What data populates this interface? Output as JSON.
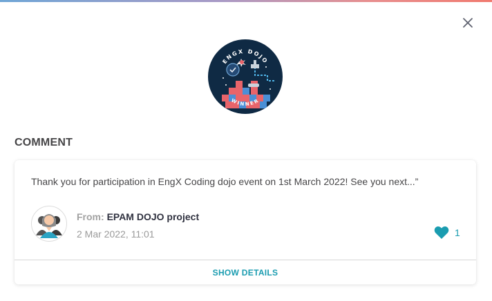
{
  "dialog": {
    "close_icon": "close-icon",
    "badge": {
      "top_text": "ENGX DOJO",
      "bottom_text": "WINNER",
      "background_color": "#0f2a44",
      "accent_color": "#e8646a"
    }
  },
  "section": {
    "title": "COMMENT"
  },
  "comment": {
    "text": "Thank you for participation in EngX Coding dojo event on 1st March 2022! See you next...”",
    "from_label": "From:",
    "from_name": "EPAM DOJO project",
    "date": "2 Mar 2022, 11:01",
    "like_count": "1",
    "like_icon": "heart-icon",
    "show_details_label": "SHOW DETAILS"
  },
  "colors": {
    "accent": "#1a9cb0",
    "text_primary": "#464547",
    "text_muted": "#9a9a9a"
  }
}
